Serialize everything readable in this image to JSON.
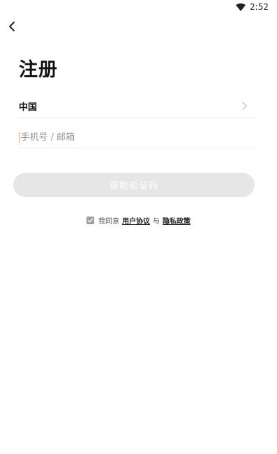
{
  "status_bar": {
    "time": "2:52",
    "wifi_icon": "wifi-icon"
  },
  "nav": {
    "back_icon": "chevron-left-icon"
  },
  "title": "注册",
  "country": {
    "label": "中国",
    "chevron_icon": "chevron-right-icon"
  },
  "phone": {
    "value": "",
    "placeholder": "手机号 / 邮箱"
  },
  "get_code_button": {
    "label": "获取验证码"
  },
  "agreement": {
    "checked": true,
    "prefix": "我同意",
    "user_agreement": "用户协议",
    "and": "与",
    "privacy_policy": "隐私政策"
  },
  "colors": {
    "accent_cursor": "#f2a73b",
    "button_disabled_bg": "#e6e6e6",
    "checkbox_bg": "#9d9d9d"
  }
}
